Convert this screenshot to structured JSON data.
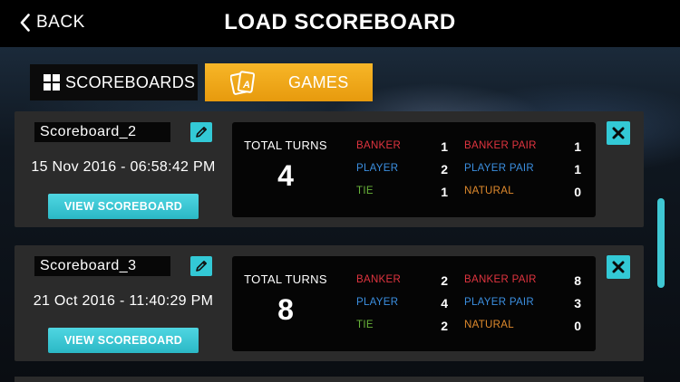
{
  "header": {
    "back_label": "BACK",
    "title": "LOAD SCOREBOARD"
  },
  "tabs": {
    "scoreboards_label": "SCOREBOARDS",
    "games_label": "GAMES"
  },
  "colors": {
    "accent_cyan": "#33c9d6",
    "accent_orange": "#f0a81a",
    "banker_red": "#e0343f",
    "player_blue": "#3b8fe0",
    "tie_green": "#69b53a",
    "natural_orange": "#e08a2c"
  },
  "labels": {
    "total_turns": "TOTAL TURNS",
    "banker": "BANKER",
    "player": "PLAYER",
    "tie": "TIE",
    "banker_pair": "BANKER PAIR",
    "player_pair": "PLAYER PAIR",
    "natural": "NATURAL",
    "view_scoreboard": "VIEW SCOREBOARD"
  },
  "scoreboards": [
    {
      "name": "Scoreboard_2",
      "date": "15 Nov 2016 - 06:58:42 PM",
      "total_turns": "4",
      "banker": "1",
      "player": "2",
      "tie": "1",
      "banker_pair": "1",
      "player_pair": "1",
      "natural": "0"
    },
    {
      "name": "Scoreboard_3",
      "date": "21 Oct 2016 - 11:40:29 PM",
      "total_turns": "8",
      "banker": "2",
      "player": "4",
      "tie": "2",
      "banker_pair": "8",
      "player_pair": "3",
      "natural": "0"
    }
  ]
}
